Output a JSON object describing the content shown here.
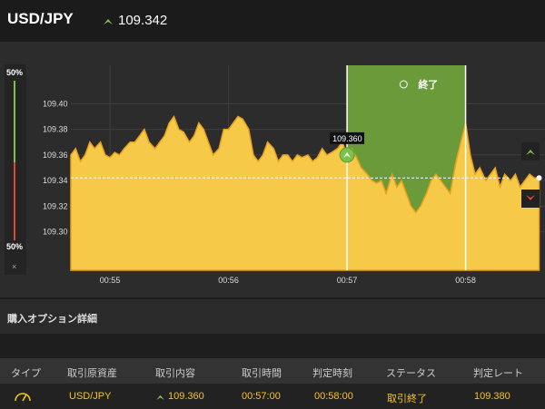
{
  "header": {
    "pair": "USD/JPY",
    "price": "109.342",
    "icon": "up-arrow-icon"
  },
  "gauge": {
    "top_label": "50%",
    "bottom_label": "50%",
    "close": "×"
  },
  "chart_data": {
    "type": "area",
    "y_ticks": [
      "109.40",
      "109.38",
      "109.36",
      "109.34",
      "109.32",
      "109.30"
    ],
    "ylim": [
      109.27,
      109.43
    ],
    "x_ticks": [
      "00:55",
      "00:56",
      "00:57",
      "00:58"
    ],
    "xlim": [
      54.67,
      58.67
    ],
    "current_rate": 109.342,
    "entry": {
      "time": 57.0,
      "rate": 109.36,
      "label": "109.360"
    },
    "expiry": {
      "time": 58.0
    },
    "expiry_label": "終了",
    "series": [
      {
        "x": [
          54.67,
          54.71,
          54.75,
          54.79,
          54.83,
          54.87,
          54.92,
          54.96,
          55.0,
          55.04,
          55.08,
          55.12,
          55.17,
          55.21,
          55.25,
          55.29,
          55.33,
          55.38,
          55.42,
          55.46,
          55.5,
          55.54,
          55.58,
          55.62,
          55.67,
          55.71,
          55.75,
          55.79,
          55.83,
          55.87,
          55.92,
          55.96,
          56.0,
          56.04,
          56.08,
          56.12,
          56.17,
          56.21,
          56.25,
          56.29,
          56.33,
          56.38,
          56.42,
          56.46,
          56.5,
          56.54,
          56.58,
          56.62,
          56.67,
          56.71,
          56.75,
          56.79,
          56.83,
          56.87,
          56.92,
          56.96,
          57.0,
          57.04,
          57.08,
          57.12,
          57.17,
          57.21,
          57.25,
          57.29,
          57.33,
          57.38,
          57.42,
          57.46,
          57.5,
          57.54,
          57.58,
          57.62,
          57.67,
          57.71,
          57.75,
          57.79,
          57.83,
          57.87,
          57.92,
          57.96,
          58.0,
          58.04,
          58.08,
          58.12,
          58.17,
          58.21,
          58.25,
          58.29,
          58.33,
          58.38,
          58.42,
          58.46,
          58.5,
          58.54,
          58.58,
          58.62
        ],
        "y": [
          109.36,
          109.365,
          109.355,
          109.36,
          109.37,
          109.365,
          109.37,
          109.36,
          109.358,
          109.362,
          109.36,
          109.365,
          109.37,
          109.37,
          109.375,
          109.38,
          109.37,
          109.365,
          109.37,
          109.375,
          109.385,
          109.39,
          109.38,
          109.378,
          109.37,
          109.375,
          109.385,
          109.38,
          109.37,
          109.36,
          109.365,
          109.38,
          109.38,
          109.385,
          109.39,
          109.388,
          109.38,
          109.36,
          109.355,
          109.36,
          109.37,
          109.365,
          109.355,
          109.36,
          109.36,
          109.355,
          109.36,
          109.358,
          109.36,
          109.355,
          109.358,
          109.365,
          109.36,
          109.362,
          109.365,
          109.37,
          109.36,
          109.365,
          109.358,
          109.35,
          109.345,
          109.34,
          109.338,
          109.34,
          109.33,
          109.345,
          109.335,
          109.34,
          109.33,
          109.32,
          109.315,
          109.32,
          109.33,
          109.34,
          109.345,
          109.34,
          109.335,
          109.33,
          109.355,
          109.37,
          109.385,
          109.36,
          109.345,
          109.35,
          109.34,
          109.345,
          109.35,
          109.335,
          109.345,
          109.34,
          109.345,
          109.335,
          109.34,
          109.345,
          109.342,
          109.342
        ]
      }
    ]
  },
  "detail": {
    "title": "購入オプション詳細"
  },
  "table": {
    "headers": [
      "タイプ",
      "取引原資産",
      "取引内容",
      "取引時間",
      "判定時刻",
      "ステータス",
      "判定レート"
    ],
    "row": {
      "type_icon": "gauge-icon",
      "asset": "USD/JPY",
      "direction_icon": "up-arrow-icon",
      "content": "109.360",
      "trade_time": "00:57:00",
      "judge_time": "00:58:00",
      "status": "取引終了",
      "rate": "109.380"
    }
  },
  "colors": {
    "area": "#f7c948",
    "area_stroke": "#e8a11c",
    "expiry_zone": "#6a9a3a",
    "up": "#7cc24a",
    "down": "#e0443a"
  }
}
